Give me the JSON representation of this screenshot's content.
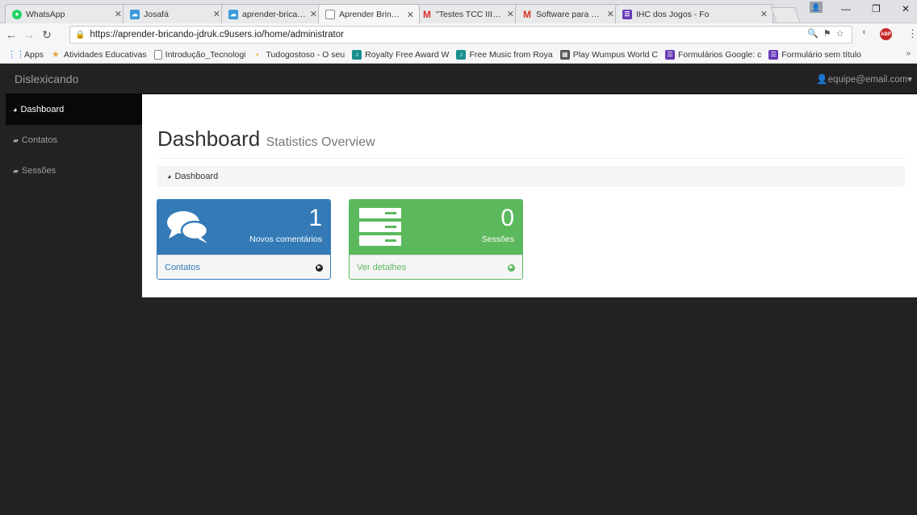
{
  "browser": {
    "tabs": [
      {
        "title": "WhatsApp",
        "favicon": "whatsapp-icon",
        "color": "#25d366"
      },
      {
        "title": "Josafá",
        "favicon": "cloud9-icon",
        "color": "#3b9ad9"
      },
      {
        "title": "aprender-bricando",
        "favicon": "cloud9-icon",
        "color": "#3b9ad9"
      },
      {
        "title": "Aprender Brincand",
        "favicon": "page-icon",
        "color": "#ffffff"
      },
      {
        "title": "\"Testes TCC III\" - ja",
        "favicon": "gmail-icon",
        "color": "#d93025"
      },
      {
        "title": "Software para crian",
        "favicon": "gmail-icon",
        "color": "#d93025"
      },
      {
        "title": "IHC dos Jogos - Fo",
        "favicon": "forms-icon",
        "color": "#673ab7"
      }
    ],
    "active_tab": 3,
    "url": "https://aprender-bricando-jdruk.c9users.io/home/administrator",
    "bookmarks": [
      {
        "label": "Apps",
        "icon": "apps-grid-icon",
        "color": "#4285f4"
      },
      {
        "label": "Atividades Educativas",
        "icon": "bookmark-icon",
        "color": "#e8a33c"
      },
      {
        "label": "Introdução_Tecnologi",
        "icon": "page-icon",
        "color": "#ffffff"
      },
      {
        "label": "Tudogostoso - O seu",
        "icon": "bookmark-icon",
        "color": "#f0a030"
      },
      {
        "label": "Royalty Free Award W",
        "icon": "bookmark-icon",
        "color": "#1a8f8f"
      },
      {
        "label": "Free Music from Roya",
        "icon": "bookmark-icon",
        "color": "#1a8f8f"
      },
      {
        "label": "Play Wumpus World C",
        "icon": "bookmark-icon",
        "color": "#555555"
      },
      {
        "label": "Formulários Google: c",
        "icon": "forms-icon",
        "color": "#673ab7"
      },
      {
        "label": "Formulário sem título",
        "icon": "forms-icon",
        "color": "#673ab7"
      }
    ],
    "bookmarks_more": "»"
  },
  "app": {
    "brand": "Dislexicando",
    "user": "equipe@email.com",
    "sidebar": [
      {
        "label": "Dashboard",
        "icon": "dashboard-icon"
      },
      {
        "label": "Contatos",
        "icon": "comment-icon"
      },
      {
        "label": "Sessões",
        "icon": "comment-icon"
      }
    ],
    "page_title": "Dashboard",
    "page_subtitle": "Statistics Overview",
    "breadcrumb": "Dashboard",
    "panels": [
      {
        "count": "1",
        "label": "Novos comentários",
        "footer": "Contatos",
        "icon": "comments-icon",
        "color": "#337ab7"
      },
      {
        "count": "0",
        "label": "Sessões",
        "footer": "Ver detalhes",
        "icon": "server-icon",
        "color": "#5cb85c"
      }
    ]
  }
}
